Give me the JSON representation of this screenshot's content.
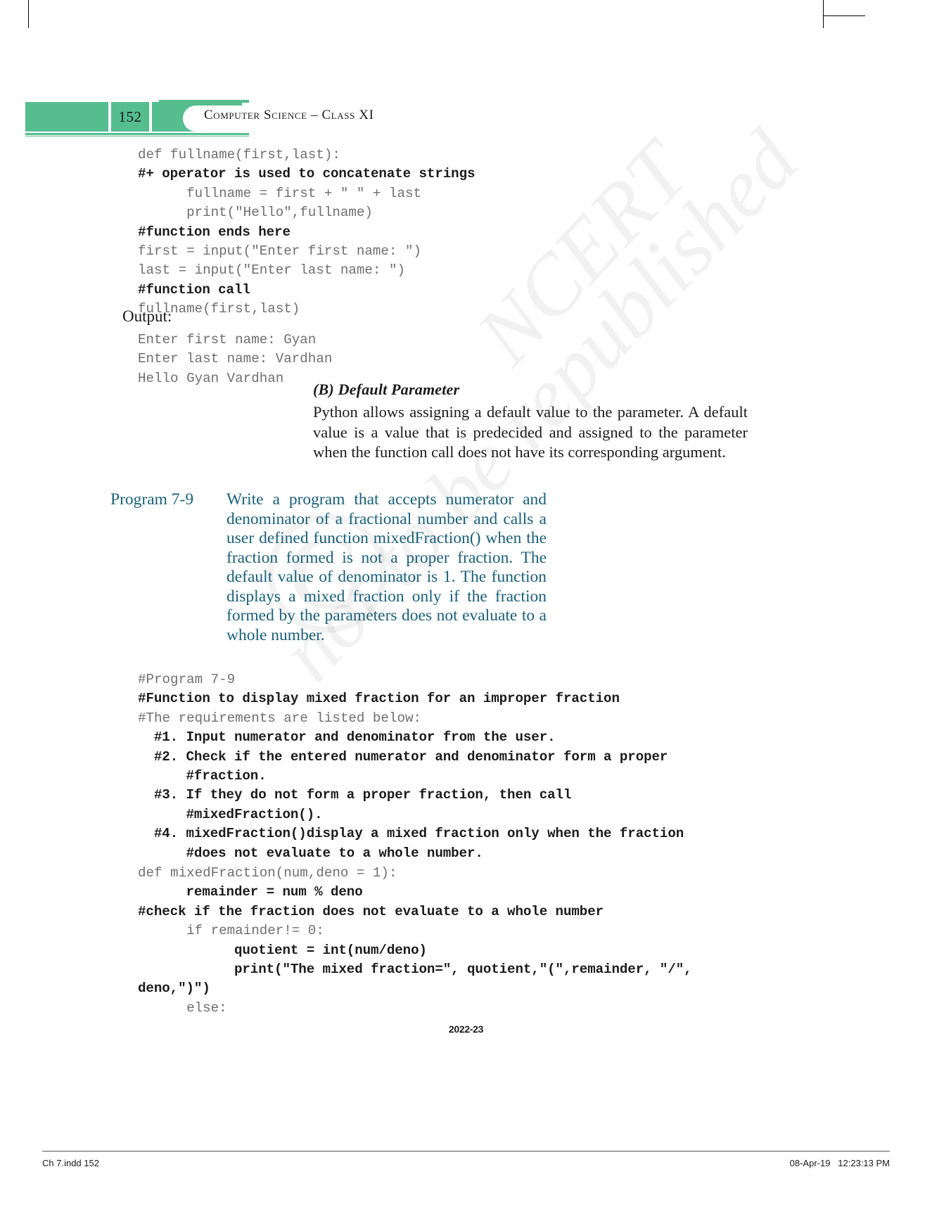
{
  "header": {
    "page_number": "152",
    "title": "Computer Science – Class XI",
    "accent_color": "#55bd8e"
  },
  "watermark": {
    "line1": "NCERT",
    "line2": "not to be republished",
    "symbol": "©"
  },
  "code_block_1": [
    {
      "text": "def fullname(first,last):",
      "style": "light"
    },
    {
      "text": "#+ operator is used to concatenate strings",
      "style": "dark"
    },
    {
      "text": "      fullname = first + \" \" + last",
      "style": "light"
    },
    {
      "text": "      print(\"Hello\",fullname)",
      "style": "light"
    },
    {
      "text": "#function ends here",
      "style": "dark"
    },
    {
      "text": "first = input(\"Enter first name: \")",
      "style": "light"
    },
    {
      "text": "last = input(\"Enter last name: \")",
      "style": "light"
    },
    {
      "text": "#function call",
      "style": "dark"
    },
    {
      "text": "fullname(first,last)",
      "style": "light"
    }
  ],
  "output_label": "Output:",
  "output_block": [
    {
      "text": "Enter first name: Gyan",
      "style": "light"
    },
    {
      "text": "Enter last name: Vardhan",
      "style": "light"
    },
    {
      "text": "Hello Gyan Vardhan",
      "style": "light"
    }
  ],
  "section_b": {
    "heading": "(B) Default Parameter",
    "body": "Python allows assigning a default value to the parameter. A default value is a value that is predecided and assigned to the parameter when the function call does not have its corresponding argument."
  },
  "program": {
    "label": "Program 7-9",
    "text": "Write a program that accepts numerator and denominator of a fractional number and calls a user defined function mixedFraction() when the fraction formed is not a proper fraction. The default value of denominator is 1. The function displays a mixed fraction only if the fraction formed by the parameters does not evaluate to a whole number.",
    "color": "#1a6079"
  },
  "code_block_2": [
    {
      "text": "#Program 7-9",
      "style": "light"
    },
    {
      "text": "#Function to display mixed fraction for an improper fraction",
      "style": "dark"
    },
    {
      "text": "#The requirements are listed below:",
      "style": "light"
    },
    {
      "text": "  #1. Input numerator and denominator from the user.",
      "style": "dark"
    },
    {
      "text": "  #2. Check if the entered numerator and denominator form a proper",
      "style": "dark"
    },
    {
      "text": "      #fraction.",
      "style": "dark"
    },
    {
      "text": "  #3. If they do not form a proper fraction, then call",
      "style": "dark"
    },
    {
      "text": "      #mixedFraction().",
      "style": "dark"
    },
    {
      "text": "  #4. mixedFraction()display a mixed fraction only when the fraction",
      "style": "dark"
    },
    {
      "text": "      #does not evaluate to a whole number.",
      "style": "dark"
    }
  ],
  "code_block_3": [
    {
      "text": "def mixedFraction(num,deno = 1):",
      "style": "light"
    },
    {
      "text": "      remainder = num % deno",
      "style": "dark"
    },
    {
      "text": "#check if the fraction does not evaluate to a whole number",
      "style": "dark"
    },
    {
      "text": "      if remainder!= 0:",
      "style": "light"
    },
    {
      "text": "            quotient = int(num/deno)",
      "style": "dark"
    },
    {
      "text": "            print(\"The mixed fraction=\", quotient,\"(\",remainder, \"/\",",
      "style": "dark"
    },
    {
      "text": "deno,\")\")",
      "style": "dark"
    },
    {
      "text": "      else:",
      "style": "light"
    }
  ],
  "footer": {
    "year": "2022-23",
    "file": "Ch 7.indd   152",
    "stamp": "08-Apr-19   12:23:13 PM"
  }
}
